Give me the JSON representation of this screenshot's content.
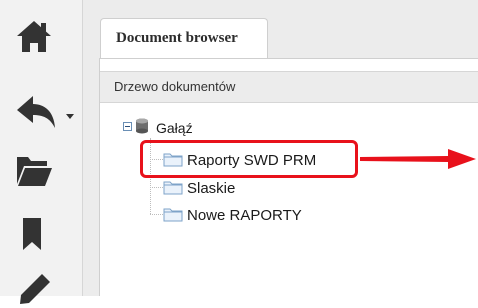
{
  "sidebar": {
    "items": [
      {
        "icon": "home-icon"
      },
      {
        "icon": "share-dropdown-icon"
      },
      {
        "icon": "folder-open-icon"
      },
      {
        "icon": "bookmark-icon"
      },
      {
        "icon": "pencil-icon"
      }
    ]
  },
  "tabs": [
    {
      "label": "Document browser"
    }
  ],
  "panel": {
    "title": "Drzewo dokumentów",
    "tree": {
      "root": {
        "label": "Gałąź",
        "icon": "database-icon"
      },
      "children": [
        {
          "label": "Raporty SWD PRM",
          "highlighted": true
        },
        {
          "label": "Slaskie"
        },
        {
          "label": "Nowe RAPORTY"
        }
      ]
    }
  },
  "colors": {
    "highlight": "#e8111b",
    "icon": "#333333"
  }
}
